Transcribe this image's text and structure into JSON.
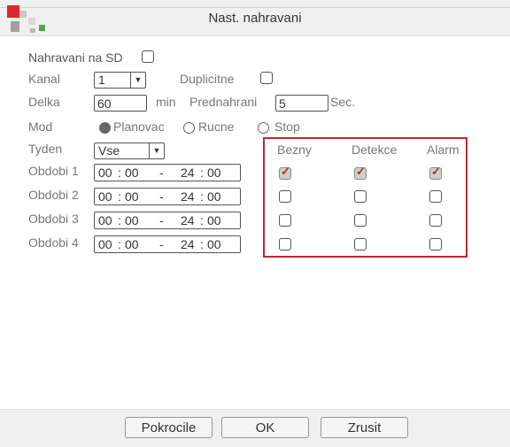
{
  "window": {
    "title": "Nast. nahravani"
  },
  "colors": {
    "accent": "#c0272d",
    "logo_red": "#e0262a",
    "logo_green": "#4da840",
    "logo_gray": "#a0a0a0"
  },
  "form": {
    "record_sd_label": "Nahravani na SD",
    "record_sd_checked": false,
    "channel_label": "Kanal",
    "channel_value": "1",
    "duplicate_label": "Duplicitne",
    "duplicate_checked": false,
    "length_label": "Delka",
    "length_value": "60",
    "length_unit": "min",
    "prerecord_label": "Prednahrani",
    "prerecord_value": "5",
    "prerecord_unit": "Sec.",
    "mode_label": "Mod",
    "mode_options": [
      "Planovac",
      "Rucne",
      "Stop"
    ],
    "mode_selected": "Planovac",
    "week_label": "Tyden",
    "week_value": "Vse"
  },
  "periods": [
    {
      "label": "Obdobi 1",
      "start_h": "00",
      "start_m": "00",
      "dash": "-",
      "end_h": "24",
      "end_m": "00",
      "bezny": true,
      "detekce": true,
      "alarm": true
    },
    {
      "label": "Obdobi 2",
      "start_h": "00",
      "start_m": "00",
      "dash": "-",
      "end_h": "24",
      "end_m": "00",
      "bezny": false,
      "detekce": false,
      "alarm": false
    },
    {
      "label": "Obdobi 3",
      "start_h": "00",
      "start_m": "00",
      "dash": "-",
      "end_h": "24",
      "end_m": "00",
      "bezny": false,
      "detekce": false,
      "alarm": false
    },
    {
      "label": "Obdobi 4",
      "start_h": "00",
      "start_m": "00",
      "dash": "-",
      "end_h": "24",
      "end_m": "00",
      "bezny": false,
      "detekce": false,
      "alarm": false
    }
  ],
  "columns": {
    "bezny": "Bezny",
    "detekce": "Detekce",
    "alarm": "Alarm"
  },
  "footer": {
    "advanced": "Pokrocile",
    "ok": "OK",
    "cancel": "Zrusit"
  }
}
